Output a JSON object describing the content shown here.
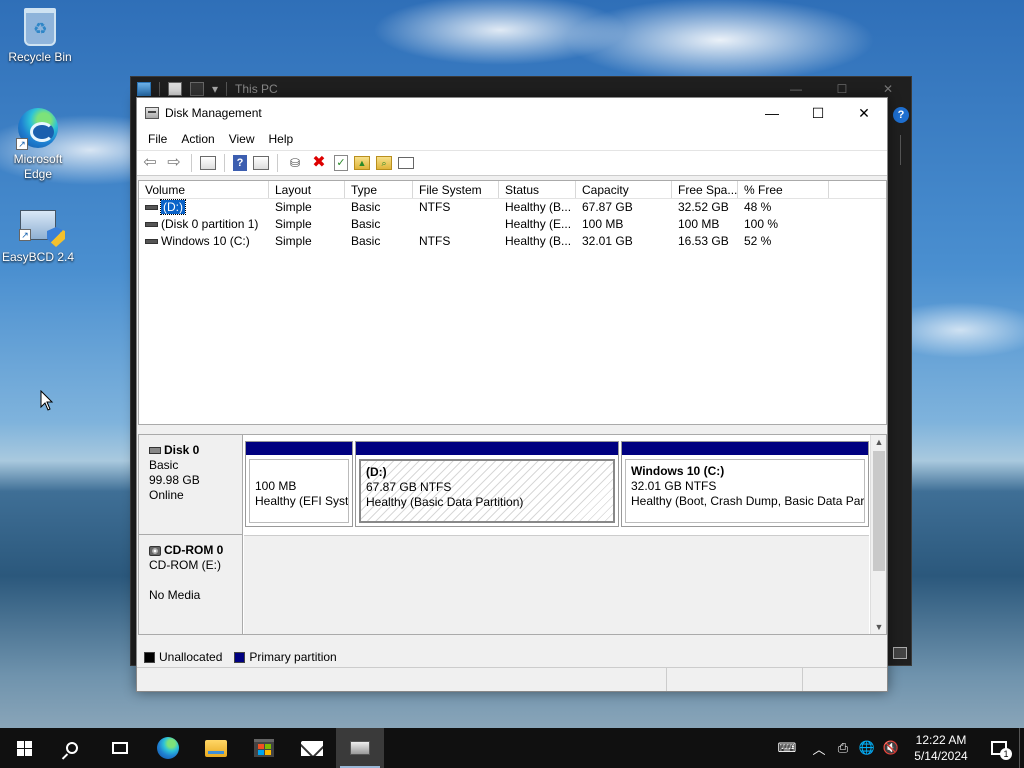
{
  "desktop": {
    "icons": [
      {
        "label": "Recycle Bin",
        "icon": "recycle-bin-icon"
      },
      {
        "label": "Microsoft Edge",
        "icon": "edge-icon"
      },
      {
        "label": "EasyBCD 2.4",
        "icon": "easybcd-icon"
      }
    ]
  },
  "explorer": {
    "title": "This PC",
    "help": "?"
  },
  "window": {
    "title": "Disk Management",
    "controls": {
      "minimize": "—",
      "maximize": "☐",
      "close": "✕"
    }
  },
  "menu": [
    "File",
    "Action",
    "View",
    "Help"
  ],
  "toolbar": [
    "back-icon",
    "forward-icon",
    "console-tree-icon",
    "help-icon",
    "export-list-icon",
    "connect-disk-icon",
    "delete-icon",
    "check-icon",
    "folder-up-icon",
    "folder-search-icon",
    "properties-icon"
  ],
  "volumes": {
    "columns": [
      "Volume",
      "Layout",
      "Type",
      "File System",
      "Status",
      "Capacity",
      "Free Spa...",
      "% Free"
    ],
    "rows": [
      {
        "volume": "(D:)",
        "layout": "Simple",
        "type": "Basic",
        "fs": "NTFS",
        "status": "Healthy (B...",
        "capacity": "67.87 GB",
        "free": "32.52 GB",
        "pct": "48 %",
        "selected": true
      },
      {
        "volume": "(Disk 0 partition 1)",
        "layout": "Simple",
        "type": "Basic",
        "fs": "",
        "status": "Healthy (E...",
        "capacity": "100 MB",
        "free": "100 MB",
        "pct": "100 %",
        "selected": false
      },
      {
        "volume": "Windows 10 (C:)",
        "layout": "Simple",
        "type": "Basic",
        "fs": "NTFS",
        "status": "Healthy (B...",
        "capacity": "32.01 GB",
        "free": "16.53 GB",
        "pct": "52 %",
        "selected": false
      }
    ]
  },
  "disks": [
    {
      "name": "Disk 0",
      "type": "Basic",
      "size": "99.98 GB",
      "state": "Online",
      "partitions": [
        {
          "title": "",
          "size": "100 MB",
          "status": "Healthy (EFI Syste"
        },
        {
          "title": "(D:)",
          "size": "67.87 GB NTFS",
          "status": "Healthy (Basic Data Partition)"
        },
        {
          "title": "Windows 10  (C:)",
          "size": "32.01 GB NTFS",
          "status": "Healthy (Boot, Crash Dump, Basic Data Parti"
        }
      ]
    },
    {
      "name": "CD-ROM 0",
      "type": "CD-ROM (E:)",
      "state": "No Media"
    }
  ],
  "legend": [
    {
      "label": "Unallocated",
      "color": "#000000"
    },
    {
      "label": "Primary partition",
      "color": "#000080"
    }
  ],
  "taskbar": {
    "apps": [
      "start-icon",
      "search-icon",
      "task-view-icon",
      "edge-icon",
      "file-explorer-icon",
      "store-icon",
      "mail-icon",
      "disk-management-icon"
    ],
    "time": "12:22 AM",
    "date": "5/14/2024",
    "notifications": "1"
  }
}
